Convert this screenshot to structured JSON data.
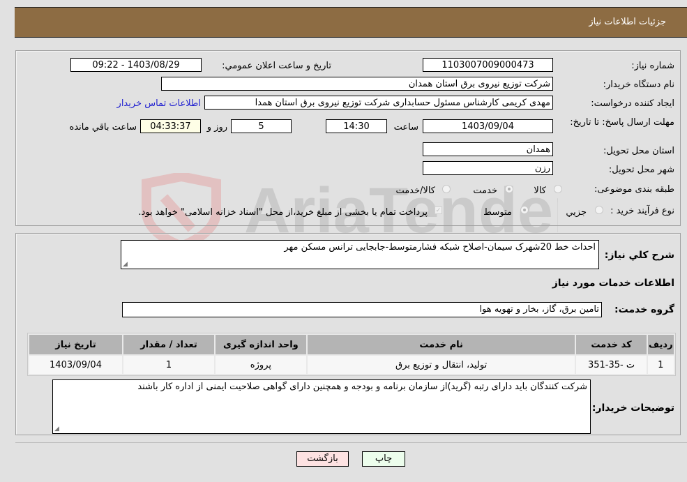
{
  "header": {
    "title": "جزئیات اطلاعات نیاز"
  },
  "form": {
    "need_number_label": "شماره نیاز:",
    "need_number": "1103007009000473",
    "announce_label": "تاریخ و ساعت اعلان عمومي:",
    "announce_value": "1403/08/29 - 09:22",
    "buyer_label": "نام دستگاه خریدار:",
    "buyer_value": "شرکت توزیع نیروی برق استان همدان",
    "creator_label": "ایجاد کننده درخواست:",
    "creator_value": "مهدی کریمی کارشناس مسئول حسابداری شرکت توزیع نیروی برق استان همدا",
    "contact_link": "اطلاعات تماس خریدار",
    "deadline_label": "مهلت ارسال پاسخ: تا تاریخ:",
    "deadline_date": "1403/09/04",
    "time_label": "ساعت",
    "deadline_time": "14:30",
    "days_value": "5",
    "days_label": "روز و",
    "remaining_time": "04:33:37",
    "remaining_label": "ساعت باقي مانده",
    "province_label": "استان محل تحویل:",
    "province_value": "همدان",
    "city_label": "شهر محل تحویل:",
    "city_value": "رزن",
    "category_label": "طبقه بندی موضوعی:",
    "category_options": [
      {
        "label": "کالا",
        "selected": false
      },
      {
        "label": "خدمت",
        "selected": true
      },
      {
        "label": "کالا/خدمت",
        "selected": false
      }
    ],
    "process_label": "نوع فرآیند خرید :",
    "process_options": [
      {
        "label": "جزيي",
        "selected": false
      },
      {
        "label": "متوسط",
        "selected": true
      }
    ],
    "treasury_checked": true,
    "treasury_text": "پرداخت تمام یا بخشی از مبلغ خرید،از محل \"اسناد خزانه اسلامی\" خواهد بود."
  },
  "details": {
    "description_label": "شرح کلي نياز:",
    "description_value": "احداث خط 20شهرک سیمان-اصلاح شبکه فشارمتوسط-جابجایی ترانس مسکن مهر",
    "services_heading": "اطلاعات خدمات مورد نياز",
    "service_group_label": "گروه خدمت:",
    "service_group_value": "تامین برق، گاز، بخار و تهویه هوا",
    "table": {
      "headers": [
        "رديف",
        "کد خدمت",
        "نام خدمت",
        "واحد اندازه گيری",
        "تعداد / مقدار",
        "تاریخ نیاز"
      ],
      "rows": [
        [
          "1",
          "ت -35-351",
          "تولید، انتقال و توزیع برق",
          "پروژه",
          "1",
          "1403/09/04"
        ]
      ]
    },
    "buyer_notes_label": "توضیحات خریدار:",
    "buyer_notes_value": "شرکت کنندگان باید دارای رتبه (گرید)از سازمان برنامه و بودجه و همچنین دارای  گواهی صلاحیت ایمنی از اداره کار باشند"
  },
  "buttons": {
    "print": "چاپ",
    "back": "بازگشت"
  },
  "watermark": {
    "text": "AriaTender.neT"
  }
}
